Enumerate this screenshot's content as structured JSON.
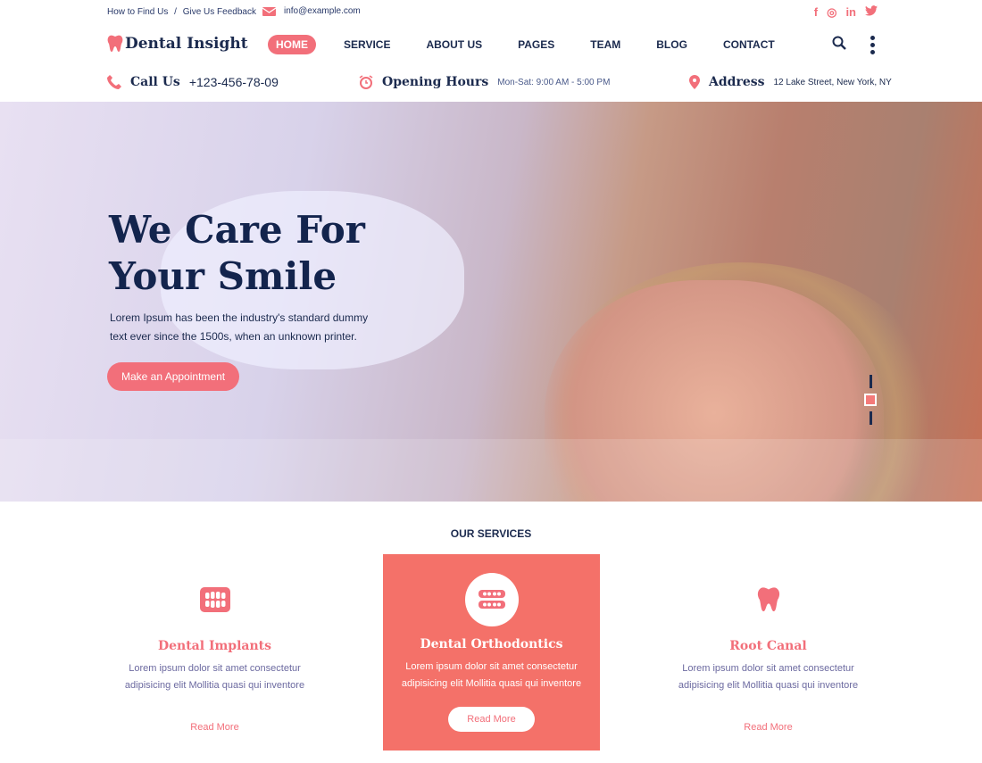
{
  "topbar": {
    "find_us": "How to Find Us",
    "separator": "/",
    "feedback": "Give Us Feedback",
    "email": "info@example.com",
    "social": [
      {
        "icon": "facebook-icon",
        "glyph": "f"
      },
      {
        "icon": "instagram-icon",
        "glyph": "◎"
      },
      {
        "icon": "linkedin-icon",
        "glyph": "in"
      },
      {
        "icon": "twitter-icon",
        "glyph": "🐦"
      }
    ]
  },
  "brand": {
    "name": "Dental Insight",
    "accent": "#f26f7a",
    "navy": "#1b2a4e"
  },
  "nav": {
    "items": [
      "HOME",
      "SERVICE",
      "ABOUT US",
      "PAGES",
      "TEAM",
      "BLOG",
      "CONTACT"
    ],
    "active": "HOME"
  },
  "info": {
    "call_label": "Call Us",
    "phone": "+123-456-78-09",
    "hours_label": "Opening Hours",
    "hours": "Mon-Sat: 9:00 AM - 5:00 PM",
    "address_label": "Address",
    "address": "12 Lake Street, New York, NY"
  },
  "hero": {
    "title_line1": "We Care For",
    "title_line2": "Your Smile",
    "text": "Lorem Ipsum has been the industry's standard dummy text ever since the 1500s, when an unknown printer.",
    "cta": "Make an Appointment",
    "slide_active": 2,
    "slide_count": 3
  },
  "services": {
    "title": "OUR SERVICES",
    "cards": [
      {
        "icon": "teeth-implant-icon",
        "title": "Dental Implants",
        "text": "Lorem ipsum dolor sit amet consectetur adipisicing elit Mollitia quasi qui inventore",
        "link": "Read More"
      },
      {
        "icon": "orthodontics-braces-icon",
        "title": "Dental Orthodontics",
        "text": "Lorem ipsum dolor sit amet consectetur adipisicing elit Mollitia quasi qui inventore",
        "link": "Read More",
        "active": true
      },
      {
        "icon": "tooth-icon",
        "title": "Root Canal",
        "text": "Lorem ipsum dolor sit amet consectetur adipisicing elit Mollitia quasi qui inventore",
        "link": "Read More"
      }
    ]
  }
}
